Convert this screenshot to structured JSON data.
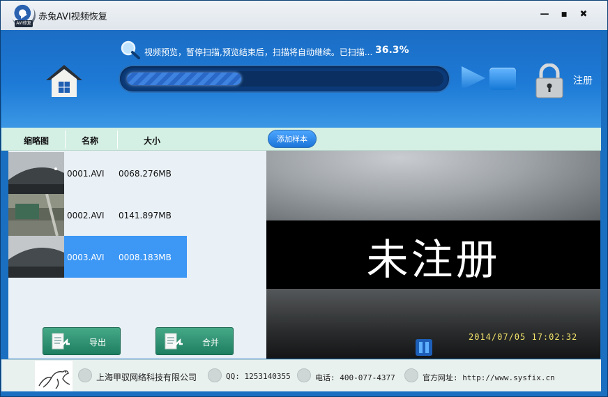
{
  "titlebar": {
    "logo_tag": "AVI修复",
    "title": "赤兔AVI视频恢复",
    "minimize": "—",
    "maximize": "■",
    "close": "✖"
  },
  "header": {
    "status_text": "视频预览，暂停扫描,预览结束后，扫描将自动继续。已扫描...",
    "progress_percent": "36.3%",
    "progress_fraction": 0.363,
    "register_label": "注册"
  },
  "columns": {
    "thumbnail": "缩略图",
    "name": "名称",
    "size": "大小",
    "add_sample": "添加样本"
  },
  "files": [
    {
      "name": "0001.AVI",
      "size": "0068.276MB",
      "selected": false
    },
    {
      "name": "0002.AVI",
      "size": "0141.897MB",
      "selected": false
    },
    {
      "name": "0003.AVI",
      "size": "0008.183MB",
      "selected": true
    }
  ],
  "actions": {
    "export_label": "导出",
    "merge_label": "合并"
  },
  "preview": {
    "watermark": "未注册",
    "timestamp": "2014/07/05  17:02:32"
  },
  "footer": {
    "company": "上海甲驭网络科技有限公司",
    "qq": "QQ: 1253140355",
    "phone": "电话: 400-077-4377",
    "website": "官方网址: http://www.sysfix.cn"
  },
  "icons": [
    "app-logo-icon",
    "home-icon",
    "search-icon",
    "play-icon",
    "stop-icon",
    "lock-icon",
    "export-icon",
    "merge-icon",
    "pause-icon",
    "company-icon",
    "qq-icon",
    "phone-icon",
    "globe-icon"
  ],
  "colors": {
    "accent": "#1d7ad6",
    "selected_row": "#3c97f5",
    "action_button": "#2d9373",
    "timestamp": "#f2e36a"
  }
}
